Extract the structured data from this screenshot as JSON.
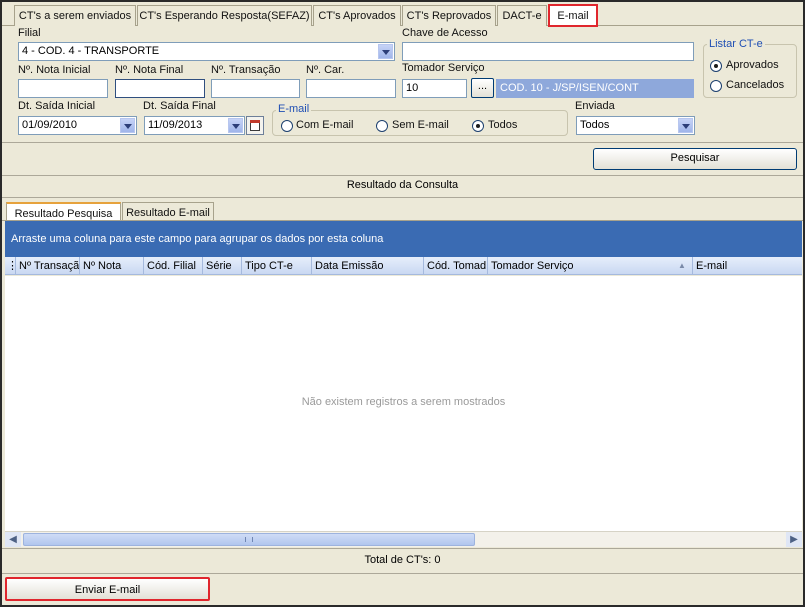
{
  "tabs": [
    {
      "label": "CT's a serem enviados"
    },
    {
      "label": "CT's Esperando Resposta(SEFAZ)"
    },
    {
      "label": "CT's Aprovados"
    },
    {
      "label": "CT's Reprovados"
    },
    {
      "label": "DACT-e"
    },
    {
      "label": "E-mail"
    }
  ],
  "form": {
    "filial_label": "Filial",
    "filial_value": "4 - COD. 4 - TRANSPORTE",
    "chave_label": "Chave de Acesso",
    "chave_value": "",
    "nota_inicial_label": "Nº. Nota Inicial",
    "nota_final_label": "Nº. Nota Final",
    "transacao_label": "Nº. Transação",
    "car_label": "Nº. Car.",
    "tomador_label": "Tomador Serviço",
    "tomador_code": "10",
    "tomador_btn": "...",
    "tomador_desc": "COD. 10 - J/SP/ISEN/CONT",
    "dt_inicial_label": "Dt. Saída Inicial",
    "dt_inicial_value": "01/09/2010",
    "dt_final_label": "Dt. Saída Final",
    "dt_final_value": "11/09/2013",
    "email_group_title": "E-mail",
    "email_options": [
      {
        "label": "Com E-mail",
        "selected": false
      },
      {
        "label": "Sem E-mail",
        "selected": false
      },
      {
        "label": "Todos",
        "selected": true
      }
    ],
    "enviada_label": "Enviada",
    "enviada_value": "Todos",
    "listar_title": "Listar CT-e",
    "listar_options": [
      {
        "label": "Aprovados",
        "selected": true
      },
      {
        "label": "Cancelados",
        "selected": false
      }
    ],
    "search_button": "Pesquisar"
  },
  "results": {
    "title": "Resultado da Consulta",
    "subtabs": [
      {
        "label": "Resultado Pesquisa"
      },
      {
        "label": "Resultado E-mail"
      }
    ],
    "group_hint": "Arraste uma coluna para este campo para agrupar os dados por esta coluna",
    "columns": [
      "Nº Transação",
      "Nº Nota",
      "Cód. Filial",
      "Série",
      "Tipo CT-e",
      "Data Emissão",
      "Cód. Tomad",
      "Tomador Serviço",
      "E-mail"
    ],
    "empty_message": "Não existem registros a serem mostrados",
    "total": "Total de CT's: 0"
  },
  "send_button": "Enviar E-mail",
  "colors": {
    "window_bg": "#ece9d8",
    "grid_group_bar": "#3a6bb3",
    "highlight": "#e0262d",
    "readonly_field": "#8ea8db"
  }
}
